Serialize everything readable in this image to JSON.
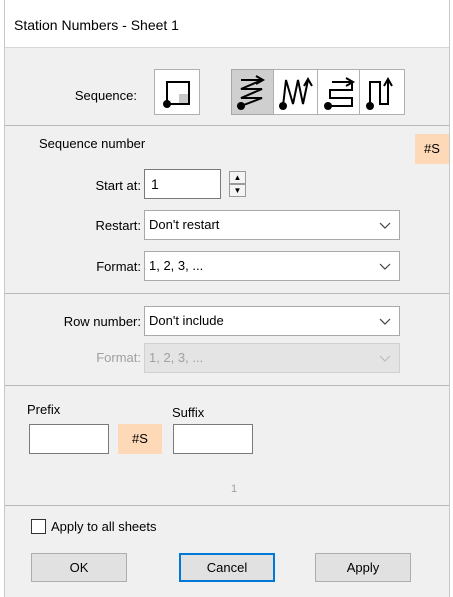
{
  "window": {
    "title": "Station Numbers - Sheet 1"
  },
  "sequence": {
    "label": "Sequence:",
    "options": [
      {
        "name": "start-corner",
        "selected": false
      },
      {
        "name": "zigzag",
        "selected": true
      },
      {
        "name": "column-snake",
        "selected": false
      },
      {
        "name": "row-snake",
        "selected": false
      },
      {
        "name": "column-up",
        "selected": false
      }
    ]
  },
  "sequence_number": {
    "heading": "Sequence number",
    "tag": "#S",
    "start_label": "Start at:",
    "start_value": "1",
    "restart_label": "Restart:",
    "restart_value": "Don't restart",
    "format_label": "Format:",
    "format_value": "1, 2, 3, ..."
  },
  "row_number": {
    "label": "Row number:",
    "value": "Don't include",
    "format_label": "Format:",
    "format_value": "1, 2, 3, ..."
  },
  "affix": {
    "prefix_label": "Prefix",
    "prefix_value": "",
    "tag": "#S",
    "suffix_label": "Suffix",
    "suffix_value": "",
    "preview": "1"
  },
  "apply_all": {
    "label": "Apply to all sheets",
    "checked": false
  },
  "buttons": {
    "ok": "OK",
    "cancel": "Cancel",
    "apply": "Apply"
  },
  "colors": {
    "tag_bg": "#fdd9b8",
    "focus": "#0078d7"
  }
}
